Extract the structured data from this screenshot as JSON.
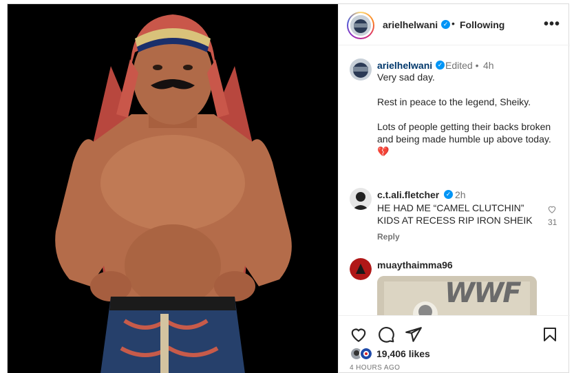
{
  "header": {
    "username": "arielhelwani",
    "separator": "•",
    "follow_state": "Following",
    "more_label": "•••",
    "verified_glyph": "✓"
  },
  "caption": {
    "username": "arielhelwani",
    "edited": "Edited •",
    "time": "4h",
    "text": "Very sad day.\n\nRest in peace to the legend, Sheiky.\n\nLots of people getting their backs broken and being made humble up above today.",
    "emoji": "💔"
  },
  "comments": [
    {
      "username": "c.t.ali.fletcher",
      "time": "2h",
      "text": "HE HAD ME “CAMEL CLUTCHIN” KIDS AT RECESS RIP IRON SHEIK",
      "likes": "31",
      "reply_label": "Reply"
    },
    {
      "username": "muaythaimma96",
      "image_text": "WWF"
    }
  ],
  "actions": {
    "like_icon": "heart-icon",
    "comment_icon": "comment-icon",
    "share_icon": "paper-plane-icon",
    "save_icon": "bookmark-icon",
    "likes_count": "19,406 likes",
    "time_ago": "4 HOURS AGO"
  },
  "colors": {
    "verified": "#0095f6",
    "caption_link": "#00376b",
    "muted": "#737373",
    "border": "#dbdbdb"
  }
}
